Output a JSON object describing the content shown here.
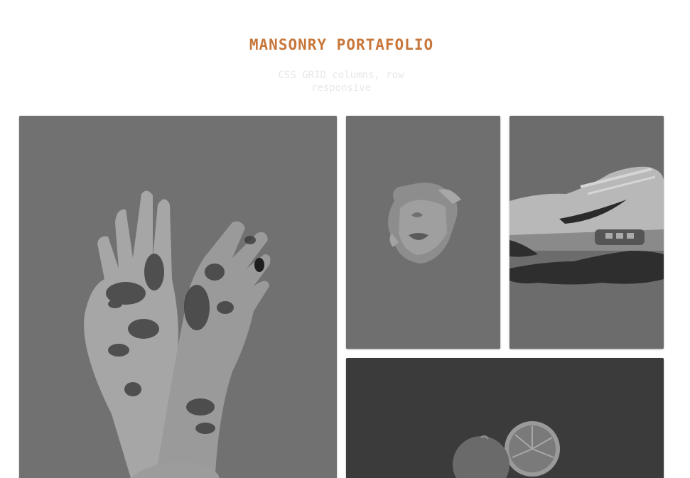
{
  "page": {
    "title": "MANSONRY PORTAFOLIO",
    "subtitle": "CSS GRID columns, row responsive"
  },
  "colors": {
    "accent": "#c8773a",
    "subtitle": "#e8e8e8",
    "tile_overlay": "#6f6f6f"
  },
  "gallery": {
    "items": [
      {
        "subject": "glitter-covered hands"
      },
      {
        "subject": "face through torn paper"
      },
      {
        "subject": "sneaker held by mannequin hand"
      },
      {
        "subject": "orange halves"
      }
    ]
  }
}
